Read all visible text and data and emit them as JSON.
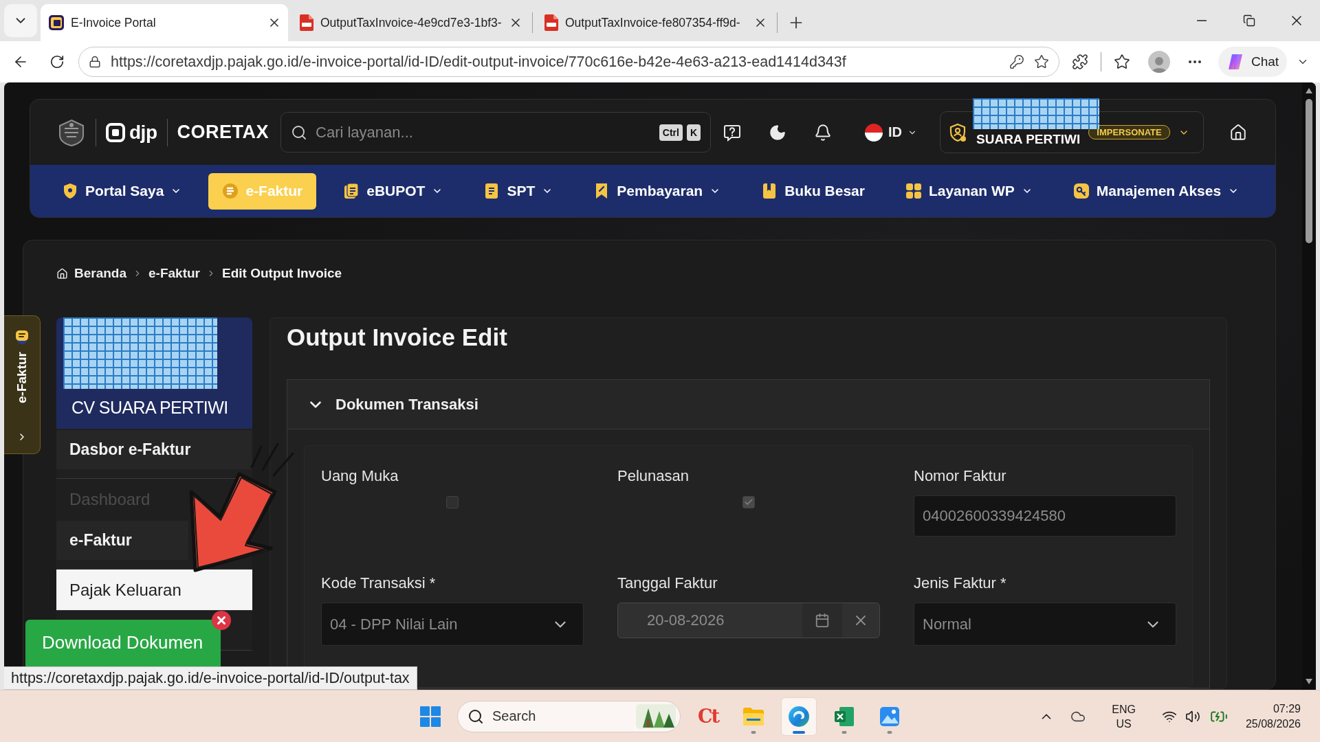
{
  "browser": {
    "tabs": [
      {
        "title": "E-Invoice Portal",
        "kind": "portal",
        "selected": true
      },
      {
        "title": "OutputTaxInvoice-4e9cd7e3-1bf3-",
        "kind": "pdf",
        "selected": false
      },
      {
        "title": "OutputTaxInvoice-fe807354-ff9d-",
        "kind": "pdf",
        "selected": false
      }
    ],
    "address": "https://coretaxdjp.pajak.go.id/e-invoice-portal/id-ID/edit-output-invoice/770c616e-b42e-4e63-a213-ead1414d343f",
    "chat_button": "Chat",
    "status_url": "https://coretaxdjp.pajak.go.id/e-invoice-portal/id-ID/output-tax"
  },
  "header": {
    "logo_djp": "djp",
    "logo_coretax": "CORETAX",
    "search": {
      "placeholder": "Cari layanan...",
      "keys": [
        "Ctrl",
        "K"
      ]
    },
    "language": "ID",
    "user": {
      "name": "SUARA PERTIWI",
      "badge": "IMPERSONATE"
    }
  },
  "nav": [
    {
      "label": "Portal Saya",
      "selected": false,
      "dropdown": true
    },
    {
      "label": "e-Faktur",
      "selected": true,
      "dropdown": false
    },
    {
      "label": "eBUPOT",
      "selected": false,
      "dropdown": true
    },
    {
      "label": "SPT",
      "selected": false,
      "dropdown": true
    },
    {
      "label": "Pembayaran",
      "selected": false,
      "dropdown": true
    },
    {
      "label": "Buku Besar",
      "selected": false,
      "dropdown": false
    },
    {
      "label": "Layanan WP",
      "selected": false,
      "dropdown": true
    },
    {
      "label": "Manajemen Akses",
      "selected": false,
      "dropdown": true
    }
  ],
  "breadcrumb": [
    "Beranda",
    "e-Faktur",
    "Edit Output Invoice"
  ],
  "side_tab": {
    "label": "e-Faktur"
  },
  "sidebar": {
    "company": "CV SUARA PERTIWI",
    "groups": [
      {
        "title": "Dasbor e-Faktur",
        "items": [
          {
            "label": "Dashboard",
            "selected": false,
            "disabled": true
          }
        ]
      },
      {
        "title": "e-Faktur",
        "items": [
          {
            "label": "Pajak Keluaran",
            "selected": true,
            "disabled": false
          }
        ]
      }
    ]
  },
  "download_button": {
    "label": "Download Dokumen"
  },
  "page_title": "Output Invoice Edit",
  "section": {
    "title": "Dokumen Transaksi",
    "expanded": true,
    "fields": [
      {
        "label": "Uang Muka",
        "kind": "checkbox",
        "checked": false,
        "disabled": true
      },
      {
        "label": "Pelunasan",
        "kind": "checkbox",
        "checked": true,
        "disabled": true
      },
      {
        "label": "Nomor Faktur",
        "kind": "text",
        "value": "04002600339424580",
        "disabled": false
      },
      {
        "label": "Kode Transaksi *",
        "kind": "select",
        "value": "04 - DPP Nilai Lain",
        "disabled": false
      },
      {
        "label": "Tanggal Faktur",
        "kind": "date",
        "value": "20-08-2026",
        "disabled": true
      },
      {
        "label": "Jenis Faktur *",
        "kind": "select",
        "value": "Normal",
        "disabled": false
      }
    ]
  },
  "taskbar": {
    "search_placeholder": "Search",
    "apps": [
      {
        "kind": "coretax",
        "logo_text": "Ct",
        "running": false,
        "selected": false
      },
      {
        "kind": "files",
        "running": true,
        "selected": false
      },
      {
        "kind": "edge",
        "running": true,
        "selected": true
      },
      {
        "kind": "excel",
        "running": true,
        "selected": false
      },
      {
        "kind": "photos",
        "running": true,
        "selected": false
      }
    ],
    "language": "ENG",
    "region": "US",
    "time": "07:29",
    "date": "25/08/2026"
  }
}
